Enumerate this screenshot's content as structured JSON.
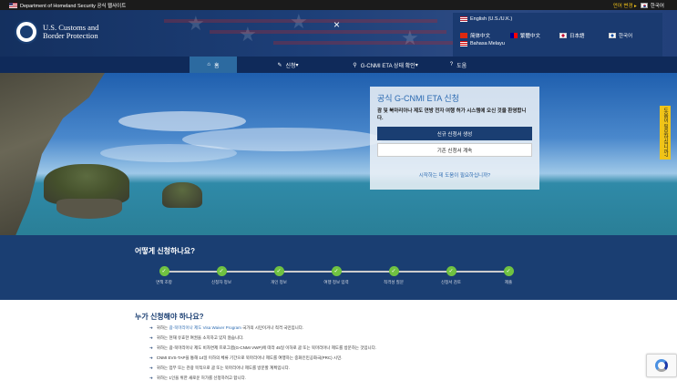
{
  "gov_banner": {
    "text": "Department of Homeland Security 공식 웹사이트",
    "lang_switch": "언어 변경 ▸",
    "current_lang": "한국어"
  },
  "header": {
    "agency_line1": "U.S. Customs and",
    "agency_line2": "Border Protection",
    "close_icon": "×"
  },
  "languages": [
    {
      "label": "English (U.S./U.K.)",
      "icon": "us-uk-flag-icon"
    },
    {
      "label": "简体中文",
      "icon": "china-flag-icon"
    },
    {
      "label": "繁體中文",
      "icon": "taiwan-flag-icon"
    },
    {
      "label": "日本語",
      "icon": "japan-flag-icon"
    },
    {
      "label": "한국어",
      "icon": "korea-flag-icon"
    },
    {
      "label": "Bahasa Melayu",
      "icon": "malaysia-flag-icon"
    }
  ],
  "nav": {
    "home": "홈",
    "apply": "신청",
    "status": "G-CNMI ETA 상태 확인",
    "help": "도움"
  },
  "cta": {
    "title": "공식 G-CNMI ETA 신청",
    "description": "괌 및 북마리아나 제도 연방 전자 여행 허가 시스템에 오신 것을 환영합니다.",
    "new_application": "신규 신청서 생성",
    "continue_application": "기존 신청서 계속",
    "help_link": "시작하는 데 도움이 필요하십니까?"
  },
  "side_tab": "도움이 필요하십니까?",
  "steps": {
    "title": "어떻게 신청하나요?",
    "items": [
      "면책 조항",
      "신청자 정보",
      "개인 정보",
      "여행 정보 입력",
      "적격성 질문",
      "신청서 검토",
      "제출"
    ]
  },
  "who": {
    "title": "누가 신청해야 하나요?",
    "items": [
      {
        "pre": "귀하는 ",
        "link": "괌-북마리아나 제도 Visa Waiver Program",
        "post": " 국가의 시민이거나 적격 국민입니다."
      },
      {
        "pre": "귀하는 현재 유효한 여권을 소지하고 있지 않습니다.",
        "link": "",
        "post": ""
      },
      {
        "pre": "귀하는 괌-북마리아나 제도 비자면제 프로그램(G-CNMI VWP)에 따라 45일 이하로 괌 또는 북마리아나 제도를 방문하는 것입니다.",
        "link": "",
        "post": ""
      },
      {
        "pre": "CNMI EVS-TAP을 통해 14일 이하의 체류 기간으로 북마리아나 제도를 여행하는 중화인민공화국(PRC) 시민.",
        "link": "",
        "post": ""
      },
      {
        "pre": "귀하는 업무 또는 관광 목적으로 괌 또는 북마리아나 제도를 방문할 계획입니다.",
        "link": "",
        "post": ""
      },
      {
        "pre": "귀하는 1인을 위한 새로운 허가를 신청하려고 합니다.",
        "link": "",
        "post": ""
      }
    ]
  },
  "colors": {
    "navy": "#1a3e72",
    "nav_active": "#2c6aa0",
    "step_done": "#70c241",
    "accent_yellow": "#f0c419"
  }
}
